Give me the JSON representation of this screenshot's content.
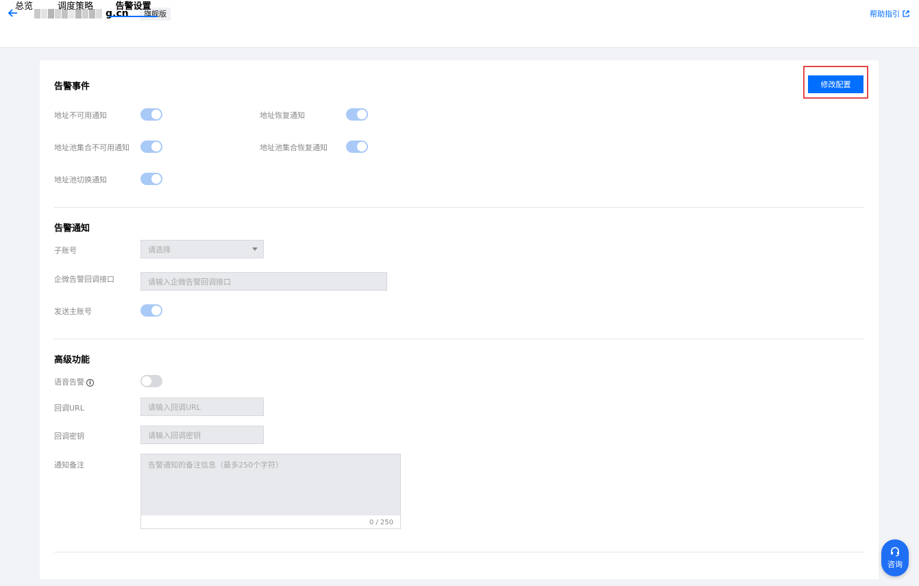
{
  "header": {
    "domain_suffix": "g.cn",
    "edition_badge": "旗舰版",
    "help_link": "帮助指引"
  },
  "tabs": [
    {
      "label": "总览",
      "active": false
    },
    {
      "label": "调度策略",
      "active": false
    },
    {
      "label": "告警设置",
      "active": true
    }
  ],
  "actions": {
    "edit_config": "修改配置"
  },
  "alarm_events": {
    "title": "告警事件",
    "items": [
      {
        "label": "地址不可用通知",
        "enabled": true
      },
      {
        "label": "地址恢复通知",
        "enabled": true
      },
      {
        "label": "地址池集合不可用通知",
        "enabled": true
      },
      {
        "label": "地址池集合恢复通知",
        "enabled": true
      },
      {
        "label": "地址池切换通知",
        "enabled": true
      }
    ]
  },
  "alarm_notify": {
    "title": "告警通知",
    "sub_account_label": "子账号",
    "sub_account_placeholder": "请选择",
    "wecom_label": "企微告警回调接口",
    "wecom_placeholder": "请输入企微告警回调接口",
    "send_main_label": "发送主账号",
    "send_main_enabled": true
  },
  "advanced": {
    "title": "高级功能",
    "voice_label": "语音告警",
    "voice_enabled": false,
    "callback_url_label": "回调URL",
    "callback_url_placeholder": "请输入回调URL",
    "callback_key_label": "回调密钥",
    "callback_key_placeholder": "请输入回调密钥",
    "remark_label": "通知备注",
    "remark_placeholder": "告警通知的备注信息（最多250个字符）",
    "remark_counter": "0 / 250"
  },
  "consult_button": "咨询",
  "colors": {
    "primary": "#006eff",
    "toggle_on": "#a9c9f7",
    "toggle_off": "#d7d9dd",
    "highlight_border": "#e54545"
  }
}
